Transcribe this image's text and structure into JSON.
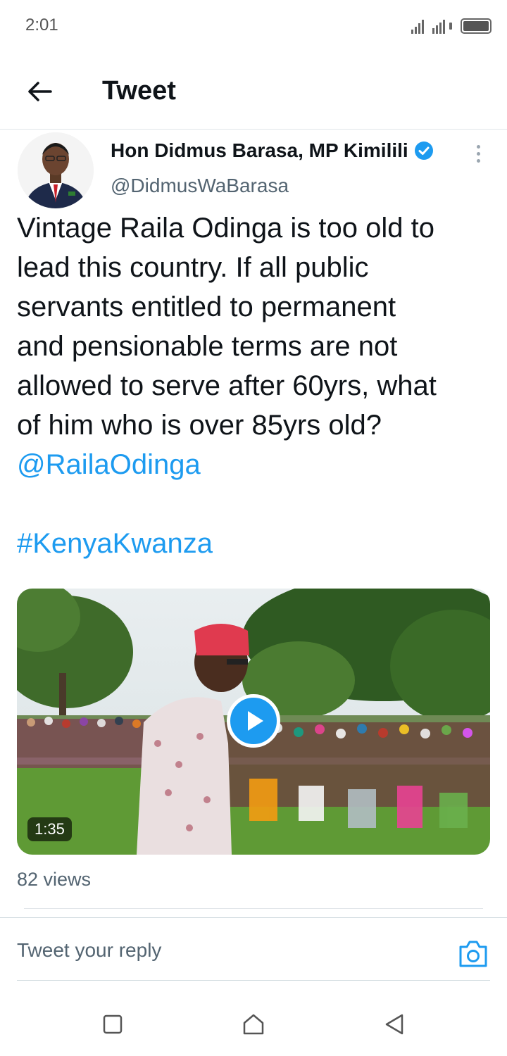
{
  "status_bar": {
    "time": "2:01",
    "icons": [
      "signal-icon",
      "signal-icon",
      "battery-icon"
    ]
  },
  "header": {
    "title": "Tweet",
    "back_icon": "arrow-left-icon"
  },
  "tweet": {
    "author_name": "Hon Didmus Barasa, MP Kimilili",
    "verified_icon": "verified-badge-icon",
    "handle": "@DidmusWaBarasa",
    "more_icon": "more-vertical-icon",
    "text_lines": [
      "Vintage Raila Odinga is too old to",
      "lead this country. If all public",
      "servants entitled to permanent",
      "and pensionable terms are not",
      "allowed to serve after 60yrs, what",
      "of him who is over 85yrs old?"
    ],
    "mention": "@RailaOdinga",
    "hashtag": "#KenyaKwanza",
    "video": {
      "duration": "1:35",
      "play_icon": "play-icon"
    },
    "views": "82 views"
  },
  "reply": {
    "placeholder": "Tweet your reply",
    "camera_icon": "camera-icon"
  },
  "nav_bar": {
    "icons": [
      "square-icon",
      "home-icon",
      "back-triangle-icon"
    ]
  },
  "colors": {
    "accent": "#1d9bf0",
    "text_primary": "#0f1419",
    "text_secondary": "#536471",
    "divider": "#cfd9de"
  }
}
